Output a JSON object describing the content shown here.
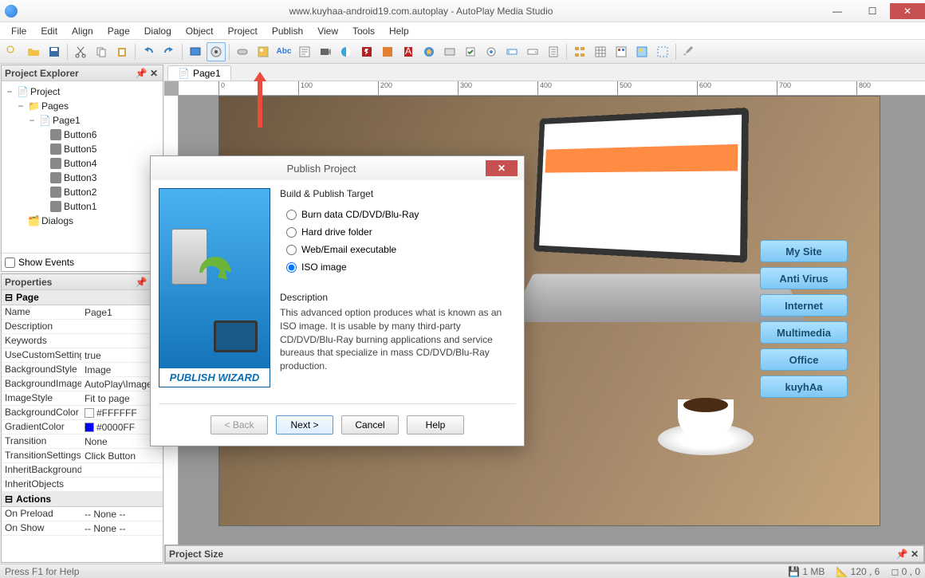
{
  "window": {
    "title": "www.kuyhaa-android19.com.autoplay - AutoPlay Media Studio"
  },
  "menu": [
    "File",
    "Edit",
    "Align",
    "Page",
    "Dialog",
    "Object",
    "Project",
    "Publish",
    "View",
    "Tools",
    "Help"
  ],
  "tabs": {
    "active": "Page1"
  },
  "ruler_marks": [
    "0",
    "100",
    "200",
    "300",
    "400",
    "500",
    "600",
    "700",
    "800"
  ],
  "explorer": {
    "title": "Project Explorer",
    "root": "Project",
    "pages_label": "Pages",
    "page1": "Page1",
    "buttons": [
      "Button6",
      "Button5",
      "Button4",
      "Button3",
      "Button2",
      "Button1"
    ],
    "dialogs_label": "Dialogs",
    "show_events": "Show Events"
  },
  "properties": {
    "title": "Properties",
    "cat_page": "Page",
    "cat_actions": "Actions",
    "rows": [
      {
        "name": "Name",
        "value": "Page1"
      },
      {
        "name": "Description",
        "value": ""
      },
      {
        "name": "Keywords",
        "value": ""
      },
      {
        "name": "UseCustomSettings",
        "value": "true"
      },
      {
        "name": "BackgroundStyle",
        "value": "Image"
      },
      {
        "name": "BackgroundImage",
        "value": "AutoPlay\\Images"
      },
      {
        "name": "ImageStyle",
        "value": "Fit to page"
      },
      {
        "name": "BackgroundColor",
        "value": "#FFFFFF",
        "swatch": "#FFFFFF"
      },
      {
        "name": "GradientColor",
        "value": "#0000FF",
        "swatch": "#0000FF"
      },
      {
        "name": "Transition",
        "value": "None"
      },
      {
        "name": "TransitionSettings",
        "value": "Click Button"
      },
      {
        "name": "InheritBackground",
        "value": ""
      },
      {
        "name": "InheritObjects",
        "value": ""
      }
    ],
    "actions": [
      {
        "name": "On Preload",
        "value": "-- None --"
      },
      {
        "name": "On Show",
        "value": "-- None --"
      }
    ]
  },
  "side_buttons": [
    "My Site",
    "Anti Virus",
    "Internet",
    "Multimedia",
    "Office",
    "kuyhAa"
  ],
  "project_size_title": "Project Size",
  "dialog": {
    "title": "Publish Project",
    "wizard_label": "PUBLISH WIZARD",
    "target_label": "Build & Publish Target",
    "options": [
      "Burn data CD/DVD/Blu-Ray",
      "Hard drive folder",
      "Web/Email executable",
      "ISO image"
    ],
    "selected_index": 3,
    "desc_label": "Description",
    "desc_text": "This advanced option produces what is known as an ISO image. It is usable by many third-party CD/DVD/Blu-Ray burning applications and service bureaus that specialize in mass CD/DVD/Blu-Ray production.",
    "back": "< Back",
    "next": "Next >",
    "cancel": "Cancel",
    "help": "Help"
  },
  "status": {
    "left": "Press F1 for Help",
    "size": "1 MB",
    "coords": "120 , 6",
    "zero": "0 , 0"
  }
}
